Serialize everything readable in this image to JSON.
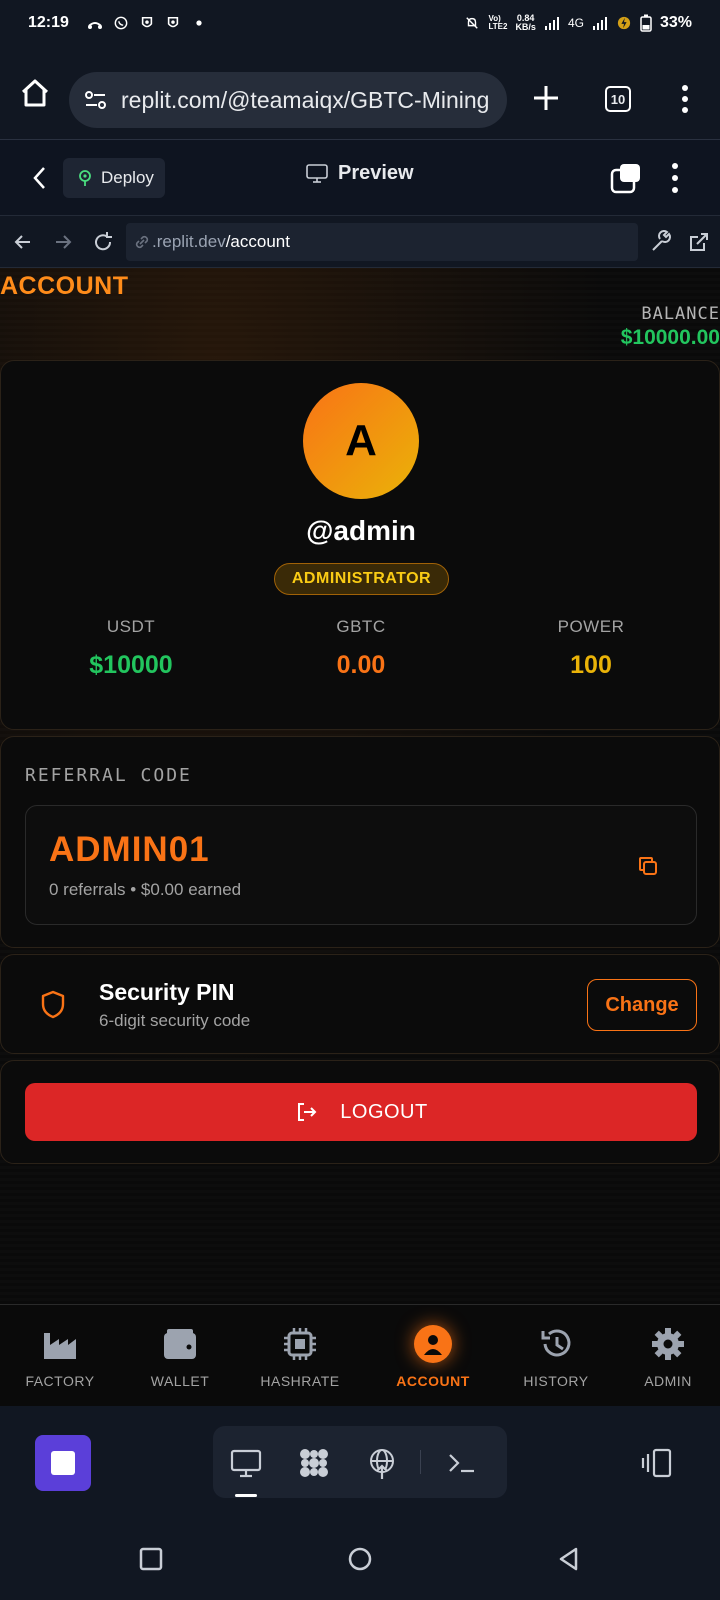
{
  "status_bar": {
    "time": "12:19",
    "net_speed": "0.84",
    "net_unit": "KB/s",
    "network": "4G",
    "battery": "33%"
  },
  "browser": {
    "url": "replit.com/@teamaiqx/GBTC-Mining",
    "tab_count": "10"
  },
  "replit_toolbar": {
    "deploy_label": "Deploy",
    "preview_label": "Preview"
  },
  "webview": {
    "url_domain": ".replit.dev",
    "url_path": "/account"
  },
  "page": {
    "title": "ACCOUNT",
    "balance_label": "BALANCE",
    "balance_value": "$10000.00"
  },
  "profile": {
    "avatar_letter": "A",
    "username": "@admin",
    "role": "ADMINISTRATOR",
    "stats": [
      {
        "label": "USDT",
        "value": "$10000",
        "color": "#22c55e"
      },
      {
        "label": "GBTC",
        "value": "0.00",
        "color": "#f97316"
      },
      {
        "label": "POWER",
        "value": "100",
        "color": "#eab308"
      }
    ]
  },
  "referral": {
    "label": "REFERRAL CODE",
    "code": "ADMIN01",
    "meta": "0 referrals • $0.00 earned"
  },
  "security": {
    "title": "Security PIN",
    "subtitle": "6-digit security code",
    "change_label": "Change"
  },
  "logout": {
    "label": "LOGOUT"
  },
  "tabs": [
    {
      "label": "FACTORY",
      "icon": "factory-icon"
    },
    {
      "label": "WALLET",
      "icon": "wallet-icon"
    },
    {
      "label": "HASHRATE",
      "icon": "chip-icon"
    },
    {
      "label": "ACCOUNT",
      "icon": "user-circle-icon",
      "active": true
    },
    {
      "label": "HISTORY",
      "icon": "history-icon"
    },
    {
      "label": "ADMIN",
      "icon": "gear-icon"
    }
  ],
  "colors": {
    "accent": "#f97316",
    "success": "#22c55e",
    "danger": "#dc2626",
    "gold": "#eab308"
  }
}
